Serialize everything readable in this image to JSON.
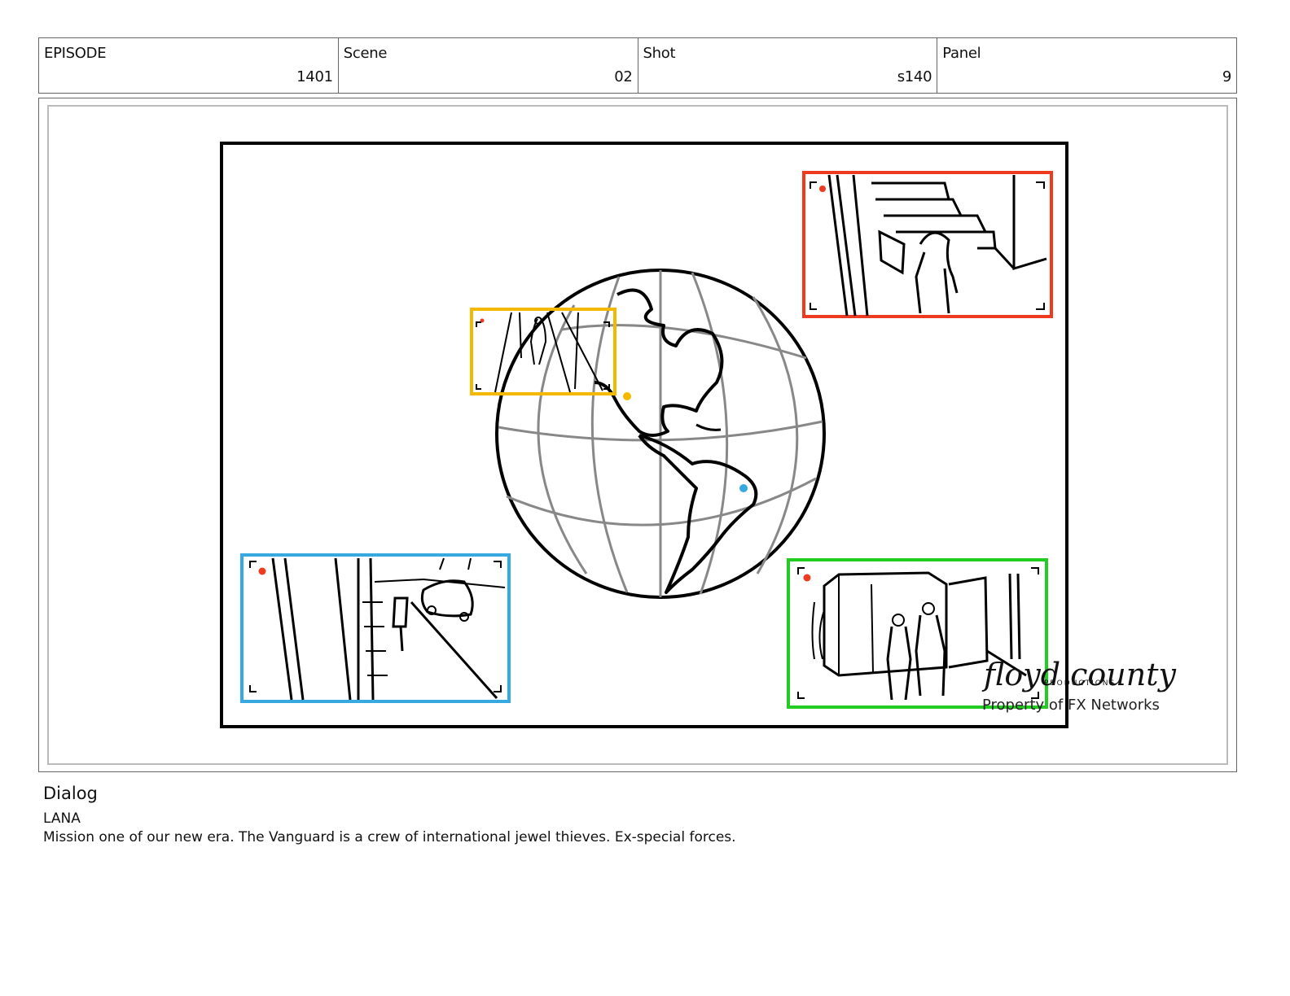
{
  "header": {
    "episode": {
      "label": "EPISODE",
      "value": "1401"
    },
    "scene": {
      "label": "Scene",
      "value": "02"
    },
    "shot": {
      "label": "Shot",
      "value": "s140"
    },
    "panel": {
      "label": "Panel",
      "value": "9"
    }
  },
  "panel_art": {
    "logo_text": "floyd county",
    "logo_subtext": "PRODUCTIONS",
    "watermark": "Property of FX Networks",
    "frame_colors": {
      "yellow": "#f5b800",
      "red": "#ee3a1e",
      "blue": "#36a9e1",
      "green": "#22cc22"
    }
  },
  "dialog": {
    "title": "Dialog",
    "speaker": "LANA",
    "line": "Mission one of our new era. The Vanguard is a crew of international jewel thieves. Ex-special forces."
  }
}
